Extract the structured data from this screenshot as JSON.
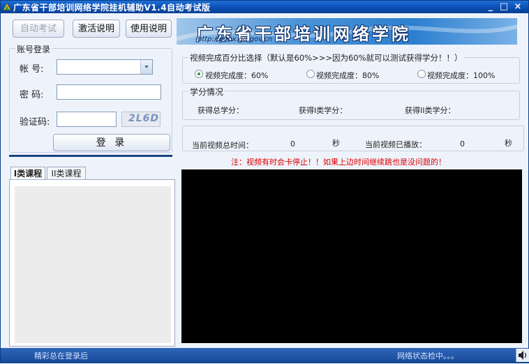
{
  "window": {
    "title": "广东省干部培训网络学院挂机辅助V1.4自动考试版",
    "minimize": "_",
    "maximize": "□",
    "close": "×"
  },
  "toolbar": {
    "auto_exam_label": "自动考试",
    "activation_label": "激活说明",
    "usage_label": "使用说明"
  },
  "banner": {
    "text": "广东省干部培训网络学院",
    "url": "http://gbpx.gd.gov.cn"
  },
  "login": {
    "group_title": "账号登录",
    "account_label": "帐  号:",
    "account_value": "",
    "password_label": "密  码:",
    "password_value": "",
    "captcha_label": "验证码:",
    "captcha_value": "",
    "captcha_image_text": "2L6D",
    "login_button": "登  录"
  },
  "course_tabs": {
    "tab1": "I类课程",
    "tab2": "II类课程"
  },
  "video_percent": {
    "group_title": "视频完成百分比选择（默认是60%>>>因为60%就可以测试获得学分！！）",
    "options": [
      {
        "label": "视频完成度：60%",
        "selected": true
      },
      {
        "label": "视频完成度：80%",
        "selected": false
      },
      {
        "label": "视频完成度：100%",
        "selected": false
      }
    ]
  },
  "credits": {
    "group_title": "学分情况",
    "total_label": "获得总学分：",
    "class1_label": "获得I类学分：",
    "class2_label": "获得II类学分："
  },
  "video_time": {
    "total_label": "当前视频总时间：",
    "total_value": "0",
    "total_unit": "秒",
    "played_label": "当前视频已播放：",
    "played_value": "0",
    "played_unit": "秒"
  },
  "notice": "注：视频有时会卡停止！！如果上边时间继续跳也是没问题的！",
  "status": {
    "left": "精彩总在登录后",
    "right": "网络状态检中。。。"
  },
  "colors": {
    "title_blue": "#0b4fb5",
    "notice_red": "#e00000",
    "player_bg": "#000000",
    "banner_blue": "#2c7fd0"
  }
}
